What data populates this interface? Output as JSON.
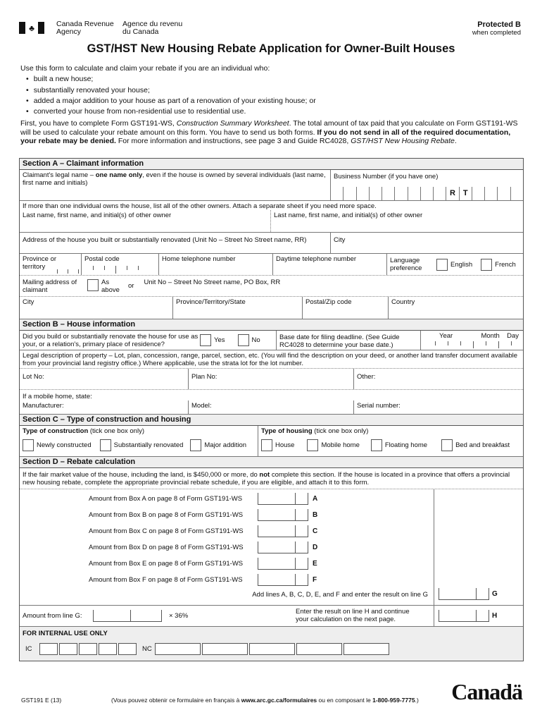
{
  "header": {
    "agency_en_1": "Canada Revenue",
    "agency_en_2": "Agency",
    "agency_fr_1": "Agence du revenu",
    "agency_fr_2": "du Canada",
    "protected_1": "Protected B",
    "protected_2": "when completed",
    "flag_icon": "maple-leaf"
  },
  "title": "GST/HST New Housing Rebate Application for Owner-Built Houses",
  "intro": {
    "lead": "Use this form to calculate and claim your rebate if you are an individual who:",
    "bullets": [
      "built a new house;",
      "substantially renovated your house;",
      "added a major addition to your house as part of a renovation of your existing house; or",
      "converted your house from non-residential use to residential use."
    ],
    "para_1": "First, you have to complete Form GST191-WS, ",
    "para_ws_italic": "Construction Summary Worksheet",
    "para_2": ". The total amount of tax paid that you calculate on Form GST191-WS will be used to calculate your rebate amount on this form. You have to send us both forms. ",
    "para_bold": "If you do not send in all of the required documentation, your rebate may be denied.",
    "para_3": " For more information and instructions, see page 3 and Guide RC4028, ",
    "para_guide_italic": "GST/HST New Housing Rebate",
    "para_end": "."
  },
  "section_a": {
    "title": "Section A – Claimant information",
    "legal_name_1": "Claimant's legal name – ",
    "legal_name_bold": "one name only",
    "legal_name_2": ", even if the house is owned by several individuals (last name, first name and initials)",
    "bn_label": "Business Number (if you have one)",
    "bn_r": "R",
    "bn_t": "T",
    "other_owners_note": "If more than one individual owns the house, list all of the other owners. Attach a separate sheet if you need more space.",
    "other_owner_1": "Last name, first name, and initial(s) of other owner",
    "other_owner_2": "Last name, first name, and initial(s) of other owner",
    "address_label": "Address of the house you built or substantially renovated (Unit No – Street No Street name, RR)",
    "city_label": "City",
    "province_label": "Province or territory",
    "postal_label": "Postal code",
    "home_phone_label": "Home telephone number",
    "day_phone_label": "Daytime telephone number",
    "lang_label": "Language preference",
    "lang_en": "English",
    "lang_fr": "French",
    "mailing_label": "Mailing address of claimant",
    "as_above": "As above",
    "or": "or",
    "mailing_street_label": "Unit No – Street No Street name, PO Box, RR",
    "mail_city": "City",
    "mail_province": "Province/Territory/State",
    "mail_postal": "Postal/Zip code",
    "mail_country": "Country"
  },
  "section_b": {
    "title": "Section B – House information",
    "question": "Did you build or substantially renovate the house for use as your, or a relation's, primary place of residence?",
    "yes": "Yes",
    "no": "No",
    "base_date": "Base date for filing deadline. (See Guide RC4028 to determine your base date.)",
    "year": "Year",
    "month": "Month",
    "day": "Day",
    "legal_desc": "Legal description of property – Lot, plan, concession, range, parcel, section, etc. (You will find the description on your deed, or another land transfer document available from your provincial land registry office.) Where applicable, use the strata lot for the lot number.",
    "lot": "Lot No:",
    "plan": "Plan No:",
    "other": "Other:",
    "mobile_note": "If a mobile home, state:",
    "manufacturer": "Manufacturer:",
    "model": "Model:",
    "serial": "Serial number:"
  },
  "section_c": {
    "title": "Section C – Type of construction and housing",
    "construction_bold": "Type of construction",
    "construction_note": " (tick one box only)",
    "housing_bold": "Type of housing",
    "housing_note": " (tick one box only)",
    "construction_options": [
      "Newly constructed",
      "Substantially renovated",
      "Major addition"
    ],
    "housing_options": [
      "House",
      "Mobile home",
      "Floating home",
      "Bed and breakfast"
    ]
  },
  "section_d": {
    "title": "Section D – Rebate calculation",
    "note_1": "If the fair market value of the house, including the land, is $450,000 or more, do ",
    "note_bold": "not",
    "note_2": " complete this section. If the house is located in a province that offers a provincial new housing rebate, complete the appropriate provincial rebate schedule, if you are eligible, and attach it to this form.",
    "lines": [
      {
        "label": "Amount from Box A on page 8 of Form GST191-WS",
        "letter": "A"
      },
      {
        "label": "Amount from Box B on page 8 of Form GST191-WS",
        "letter": "B"
      },
      {
        "label": "Amount from Box C on page 8 of Form GST191-WS",
        "letter": "C"
      },
      {
        "label": "Amount from Box D on page 8 of Form GST191-WS",
        "letter": "D"
      },
      {
        "label": "Amount from Box E on page 8 of Form GST191-WS",
        "letter": "E"
      },
      {
        "label": "Amount from Box F on page 8 of Form GST191-WS",
        "letter": "F"
      }
    ],
    "line_g_label": "Add lines A, B, C, D, E, and F and enter the result on line G",
    "line_g": "G",
    "amount_g_label": "Amount from line G:",
    "times": "× 36%",
    "line_h_label": "Enter the result on line H and continue your calculation on the next page.",
    "line_h": "H"
  },
  "internal": {
    "title": "FOR INTERNAL USE ONLY",
    "ic": "IC",
    "nc": "NC"
  },
  "footer": {
    "form_no": "GST191 E (13)",
    "french_1": "(Vous pouvez obtenir ce formulaire en français à ",
    "french_url": "www.arc.gc.ca/formulaires",
    "french_2": " ou en composant le ",
    "french_phone": "1-800-959-7775",
    "french_3": ".)",
    "wordmark": "Canadä"
  }
}
